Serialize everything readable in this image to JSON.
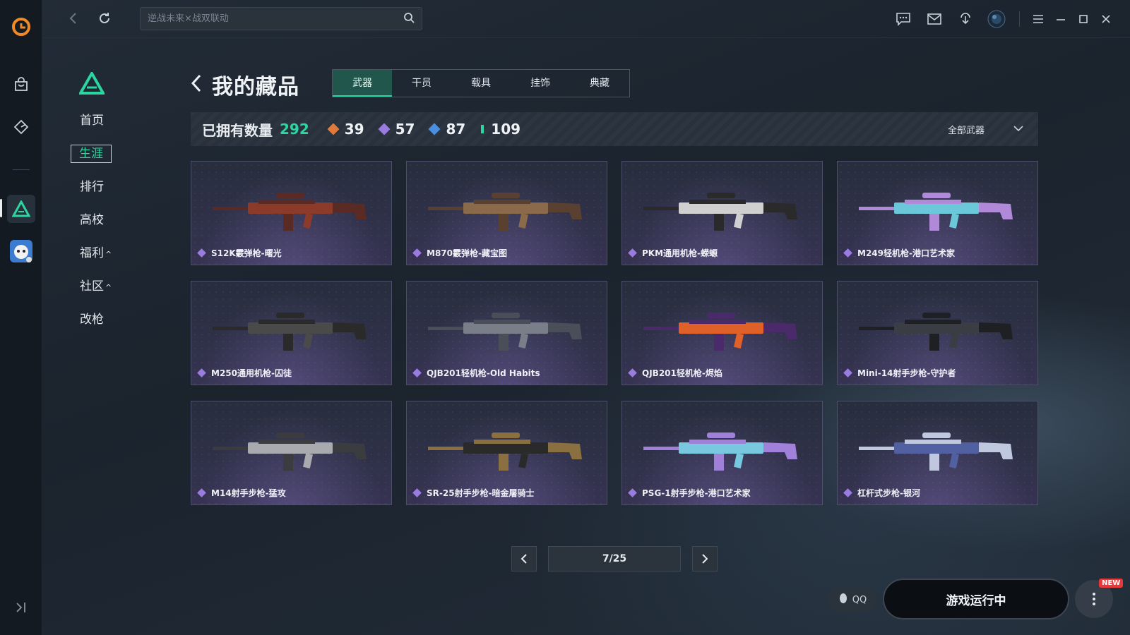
{
  "app": {
    "search_placeholder": "逆战未来×战双联动"
  },
  "sidebar_nav": {
    "items": [
      {
        "label": "首页"
      },
      {
        "label": "生涯"
      },
      {
        "label": "排行"
      },
      {
        "label": "高校"
      },
      {
        "label": "福利"
      },
      {
        "label": "社区"
      },
      {
        "label": "改枪"
      }
    ],
    "active": "生涯"
  },
  "header": {
    "title": "我的藏品",
    "tabs": [
      "武器",
      "干员",
      "载具",
      "挂饰",
      "典藏"
    ],
    "active_tab": "武器"
  },
  "stats": {
    "owned_label": "已拥有数量",
    "owned_value": "292",
    "rarities": [
      {
        "value": "39",
        "color": "#e07a3a"
      },
      {
        "value": "57",
        "color": "#9a7be0"
      },
      {
        "value": "87",
        "color": "#4a8fe0"
      },
      {
        "value": "109",
        "color": "#2bd6a0"
      }
    ],
    "filter_label": "全部武器"
  },
  "items": [
    {
      "name": "S12K霰弹枪-曙光",
      "palette": [
        "#8c3a2a",
        "#5a2a24"
      ]
    },
    {
      "name": "M870霰弹枪-藏宝图",
      "palette": [
        "#8a6a4a",
        "#5a4030"
      ]
    },
    {
      "name": "PKM通用机枪-蝾螈",
      "palette": [
        "#d0d0d0",
        "#2a2a2a"
      ]
    },
    {
      "name": "M249轻机枪-港口艺术家",
      "palette": [
        "#6ac8d8",
        "#b08ad8"
      ]
    },
    {
      "name": "M250通用机枪-囚徒",
      "palette": [
        "#4a4a4a",
        "#2a2a2a"
      ]
    },
    {
      "name": "QJB201轻机枪-Old Habits",
      "palette": [
        "#7a7e88",
        "#4a4e58"
      ]
    },
    {
      "name": "QJB201轻机枪-烬焰",
      "palette": [
        "#e0602a",
        "#4a2a6a"
      ]
    },
    {
      "name": "Mini-14射手步枪-守护者",
      "palette": [
        "#3a3d44",
        "#1e2024"
      ]
    },
    {
      "name": "M14射手步枪-猛攻",
      "palette": [
        "#a8aab0",
        "#3a3c40"
      ]
    },
    {
      "name": "SR-25射手步枪-暗金屠骑士",
      "palette": [
        "#2a2a2a",
        "#8a7040"
      ]
    },
    {
      "name": "PSG-1射手步枪-港口艺术家",
      "palette": [
        "#78c8e0",
        "#a080d8"
      ]
    },
    {
      "name": "杠杆式步枪-银河",
      "palette": [
        "#5060a0",
        "#c0c8e0"
      ]
    }
  ],
  "pagination": {
    "current": 7,
    "total": 25,
    "label": "7/25"
  },
  "footer": {
    "qq_label": "QQ",
    "run_label": "游戏运行中",
    "new_badge": "NEW"
  },
  "accent_color": "#2bd6a0"
}
